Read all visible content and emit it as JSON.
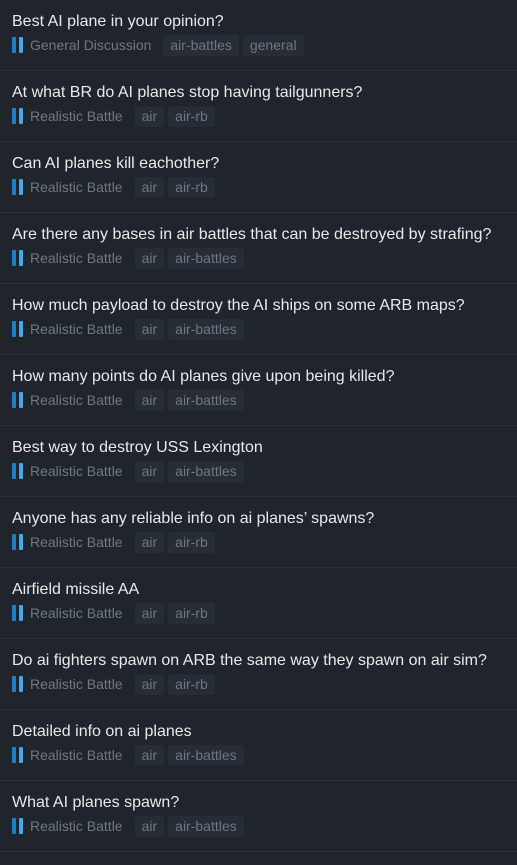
{
  "topics": [
    {
      "title": "Best AI plane in your opinion?",
      "category": "General Discussion",
      "tags": [
        "air-battles",
        "general"
      ]
    },
    {
      "title": "At what BR do AI planes stop having tailgunners?",
      "category": "Realistic Battle",
      "tags": [
        "air",
        "air-rb"
      ]
    },
    {
      "title": "Can AI planes kill eachother?",
      "category": "Realistic Battle",
      "tags": [
        "air",
        "air-rb"
      ]
    },
    {
      "title": "Are there any bases in air battles that can be destroyed by strafing?",
      "category": "Realistic Battle",
      "tags": [
        "air",
        "air-battles"
      ]
    },
    {
      "title": "How much payload to destroy the AI ships on some ARB maps?",
      "category": "Realistic Battle",
      "tags": [
        "air",
        "air-battles"
      ]
    },
    {
      "title": "How many points do AI planes give upon being killed?",
      "category": "Realistic Battle",
      "tags": [
        "air",
        "air-battles"
      ]
    },
    {
      "title": "Best way to destroy USS Lexington",
      "category": "Realistic Battle",
      "tags": [
        "air",
        "air-battles"
      ]
    },
    {
      "title": "Anyone has any reliable info on ai planes’ spawns?",
      "category": "Realistic Battle",
      "tags": [
        "air",
        "air-rb"
      ]
    },
    {
      "title": "Airfield missile AA",
      "category": "Realistic Battle",
      "tags": [
        "air",
        "air-rb"
      ]
    },
    {
      "title": "Do ai fighters spawn on ARB the same way they spawn on air sim?",
      "category": "Realistic Battle",
      "tags": [
        "air",
        "air-rb"
      ]
    },
    {
      "title": "Detailed info on ai planes",
      "category": "Realistic Battle",
      "tags": [
        "air",
        "air-battles"
      ]
    },
    {
      "title": "What AI planes spawn?",
      "category": "Realistic Battle",
      "tags": [
        "air",
        "air-battles"
      ]
    }
  ],
  "colors": {
    "background": "#20252b",
    "title_text": "#e6e9ec",
    "meta_text": "#6d7984",
    "tag_background": "#262d34",
    "category_bar_dark": "#1f7fc4",
    "category_bar_light": "#49a7e6"
  },
  "icons": {
    "category": "category-color-bars-icon"
  }
}
